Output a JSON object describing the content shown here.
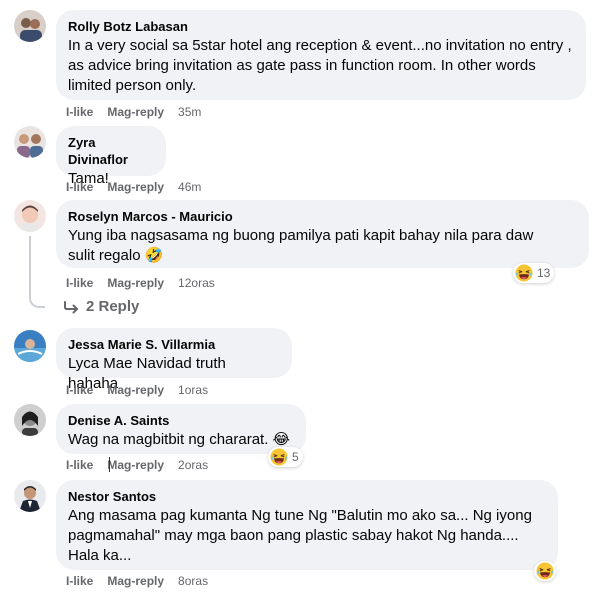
{
  "comments": [
    {
      "author": "Rolly Botz Labasan",
      "text": "In a very social sa 5star hotel ang reception & event...no invitation no entry , as advice bring invitation as gate pass in function room. In other words limited person only.",
      "like": "I-like",
      "reply": "Mag-reply",
      "time": "35m"
    },
    {
      "author": "Zyra Divinaflor",
      "text": "Tama!",
      "like": "I-like",
      "reply": "Mag-reply",
      "time": "46m"
    },
    {
      "author": "Roselyn Marcos - Mauricio",
      "text": "Yung iba nagsasama ng buong pamilya pati kapit bahay nila para daw sulit regalo 🤣",
      "like": "I-like",
      "reply": "Mag-reply",
      "time": "12oras",
      "reaction_count": "13",
      "replies_label": "2 Reply"
    },
    {
      "author": "Jessa Marie S. Villarmia",
      "text": "Lyca Mae Navidad truth hahaha",
      "like": "I-like",
      "reply": "Mag-reply",
      "time": "1oras"
    },
    {
      "author": "Denise A. Saints",
      "text": "Wag na magbitbit ng chararat. 😂",
      "like": "I-like",
      "reply": "Mag-reply",
      "time": "2oras",
      "reaction_count": "5"
    },
    {
      "author": "Nestor Santos",
      "text": "Ang masama pag kumanta Ng tune Ng \"Balutin mo ako sa... Ng iyong pagmamahal\" may mga baon pang plastic sabay hakot Ng handa.... Hala ka...",
      "like": "I-like",
      "reply": "Mag-reply",
      "time": "8oras"
    }
  ],
  "colors": {
    "bubble": "#f0f2f5",
    "secondary_text": "#65676b",
    "emoji_yellow": "#f7c533"
  },
  "icons": {
    "reaction": "laughing-emoji-icon",
    "reply_arrow": "reply-arrow-icon"
  }
}
